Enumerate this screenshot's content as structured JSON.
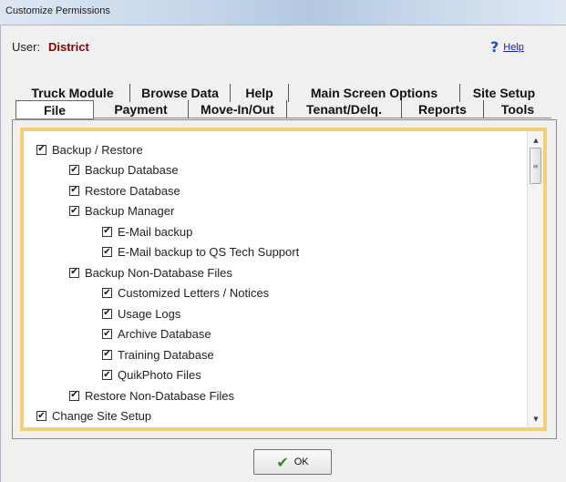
{
  "window": {
    "title": "Customize Permissions"
  },
  "user": {
    "label": "User:",
    "value": "District"
  },
  "help": {
    "icon": "question-mark-icon",
    "label": "Help"
  },
  "tabs": {
    "back_row": [
      {
        "label": "Truck Module"
      },
      {
        "label": "Browse Data"
      },
      {
        "label": "Help"
      },
      {
        "label": "Main Screen Options"
      },
      {
        "label": "Site Setup"
      }
    ],
    "front_row": [
      {
        "label": "File",
        "active": true
      },
      {
        "label": "Payment"
      },
      {
        "label": "Move-In/Out"
      },
      {
        "label": "Tenant/Delq."
      },
      {
        "label": "Reports"
      },
      {
        "label": "Tools"
      }
    ]
  },
  "permissions": [
    {
      "label": "Backup / Restore",
      "checked": true,
      "level": 0
    },
    {
      "label": "Backup Database",
      "checked": true,
      "level": 1
    },
    {
      "label": "Restore Database",
      "checked": true,
      "level": 1
    },
    {
      "label": "Backup Manager",
      "checked": true,
      "level": 1
    },
    {
      "label": "E-Mail backup",
      "checked": true,
      "level": 2
    },
    {
      "label": "E-Mail backup to QS Tech Support",
      "checked": true,
      "level": 2
    },
    {
      "label": "Backup Non-Database Files",
      "checked": true,
      "level": 1
    },
    {
      "label": "Customized Letters / Notices",
      "checked": true,
      "level": 2
    },
    {
      "label": "Usage Logs",
      "checked": true,
      "level": 2
    },
    {
      "label": "Archive Database",
      "checked": true,
      "level": 2
    },
    {
      "label": "Training Database",
      "checked": true,
      "level": 2
    },
    {
      "label": "QuikPhoto Files",
      "checked": true,
      "level": 2
    },
    {
      "label": "Restore Non-Database Files",
      "checked": true,
      "level": 1
    },
    {
      "label": "Change Site Setup",
      "checked": true,
      "level": 0
    }
  ],
  "check_glyph": "✔",
  "scrollbar": {
    "up_glyph": "▲",
    "down_glyph": "▼",
    "grip_glyph": "≡"
  },
  "ok_button": {
    "label": "OK",
    "icon": "checkmark-icon",
    "glyph": "✔",
    "accent": "#2e8b1f"
  },
  "colors": {
    "user_value": "#8b0000",
    "frame": "#f3cf78"
  }
}
